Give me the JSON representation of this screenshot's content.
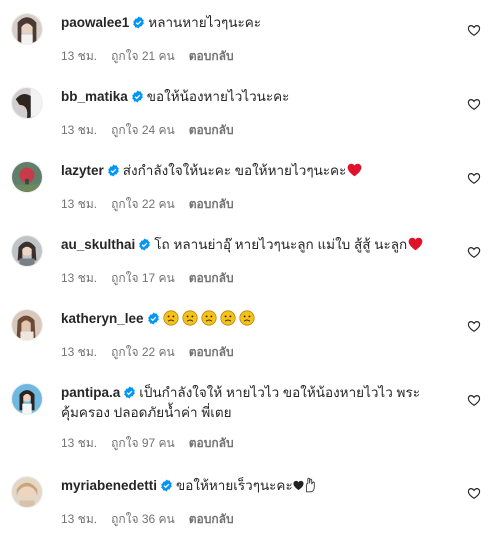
{
  "colors": {
    "verified": "#0095f6",
    "meta_text": "#737373",
    "emoji_heart": "#e0112b",
    "emoji_face": "#f4c21b"
  },
  "comments": [
    {
      "username": "paowalee1",
      "verified": true,
      "text": "หลานหายไวๆนะคะ",
      "time": "13 ชม.",
      "likes": "ถูกใจ 21 คน",
      "reply": "ตอบกลับ",
      "avatar_icon": "avatar-photo"
    },
    {
      "username": "bb_matika",
      "verified": true,
      "text": "ขอให้น้องหายไวไวนะคะ",
      "time": "13 ชม.",
      "likes": "ถูกใจ 24 คน",
      "reply": "ตอบกลับ",
      "avatar_icon": "avatar-photo"
    },
    {
      "username": "lazyter",
      "verified": true,
      "text": "ส่งกำลังใจให้นะคะ ขอให้หายไวๆนะคะ",
      "emoji": "red-heart-emoji",
      "time": "13 ชม.",
      "likes": "ถูกใจ 22 คน",
      "reply": "ตอบกลับ",
      "avatar_icon": "avatar-photo"
    },
    {
      "username": "au_skulthai",
      "verified": true,
      "text": "โถ หลานย่าอุ๊ หายไวๆนะลูก แม่ใบ สู้สู้ นะลูก",
      "emoji": "red-heart-emoji",
      "time": "13 ชม.",
      "likes": "ถูกใจ 17 คน",
      "reply": "ตอบกลับ",
      "avatar_icon": "avatar-photo"
    },
    {
      "username": "katheryn_lee",
      "verified": true,
      "text": "",
      "emoji": "sad-face-emoji-x5",
      "time": "13 ชม.",
      "likes": "ถูกใจ 22 คน",
      "reply": "ตอบกลับ",
      "avatar_icon": "avatar-photo"
    },
    {
      "username": "pantipa.a",
      "verified": true,
      "text_line1": "เป็นกำลังใจให้ หายไวไว ขอให้น้องหายไวไว พระ",
      "text_line2": "คุ้มครอง ปลอดภัยน้ำค่า พี่เตย",
      "time": "13 ชม.",
      "likes": "ถูกใจ 97 คน",
      "reply": "ตอบกลับ",
      "avatar_icon": "avatar-photo"
    },
    {
      "username": "myriabenedetti",
      "verified": true,
      "text": "ขอให้หายเร็วๆนะคะ",
      "emoji": "black-heart-and-hand-emoji",
      "time": "13 ชม.",
      "likes": "ถูกใจ 36 คน",
      "reply": "ตอบกลับ",
      "avatar_icon": "avatar-photo"
    }
  ],
  "like_icon": "heart-outline-icon"
}
